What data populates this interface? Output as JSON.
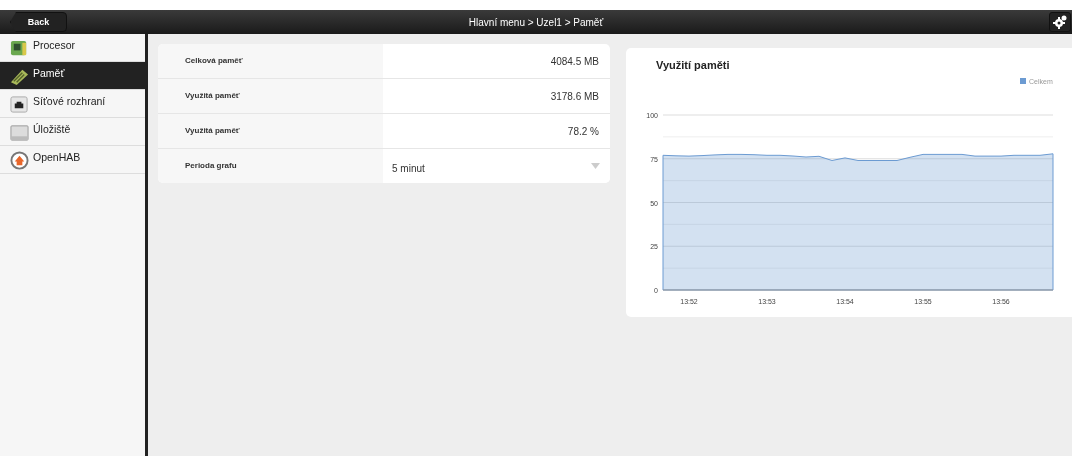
{
  "header": {
    "back_button": "Back",
    "breadcrumb": "Hlavní menu > Uzel1 > Paměť"
  },
  "sidebar": {
    "items": [
      {
        "label": "Procesor",
        "kind": "cpu",
        "selected": false
      },
      {
        "label": "Paměť",
        "kind": "ram",
        "selected": true
      },
      {
        "label": "Síťové rozhraní",
        "kind": "network",
        "selected": false
      },
      {
        "label": "Úložiště",
        "kind": "disk",
        "selected": false
      },
      {
        "label": "OpenHAB",
        "kind": "openhab",
        "selected": false
      }
    ]
  },
  "info_table": {
    "rows": [
      {
        "label": "Celková paměť",
        "value": "4084.5 MB",
        "kind": "text"
      },
      {
        "label": "Využitá paměť",
        "value": "3178.6 MB",
        "kind": "text"
      },
      {
        "label": "Využitá paměť",
        "value": "78.2 %",
        "kind": "text"
      },
      {
        "label": "Perioda grafu",
        "value": "5 minut",
        "kind": "select"
      }
    ]
  },
  "chart_panel": {
    "chart_data": {
      "type": "area",
      "title": "Využití paměti",
      "categories": [
        null,
        null,
        "13:52",
        null,
        null,
        null,
        null,
        null,
        "13:53",
        null,
        null,
        null,
        null,
        null,
        "13:54",
        null,
        null,
        null,
        null,
        null,
        "13:55",
        null,
        null,
        null,
        null,
        null,
        "13:56",
        null,
        null,
        null,
        null
      ],
      "series": [
        {
          "name": "Celkem",
          "color": "#6c9bd2",
          "values": [
            77,
            76.7,
            76.5,
            76.8,
            77.2,
            77.5,
            77.5,
            77.3,
            77,
            77,
            76.6,
            76,
            76.4,
            74,
            75.5,
            74,
            74,
            74,
            74,
            75.8,
            77.5,
            77.5,
            77.5,
            77.5,
            76.5,
            76.5,
            76.5,
            77,
            77,
            77,
            77.8
          ]
        }
      ],
      "ylim": [
        0,
        100
      ],
      "yticks": [
        0,
        25,
        50,
        75,
        100
      ],
      "grid": true
    }
  }
}
